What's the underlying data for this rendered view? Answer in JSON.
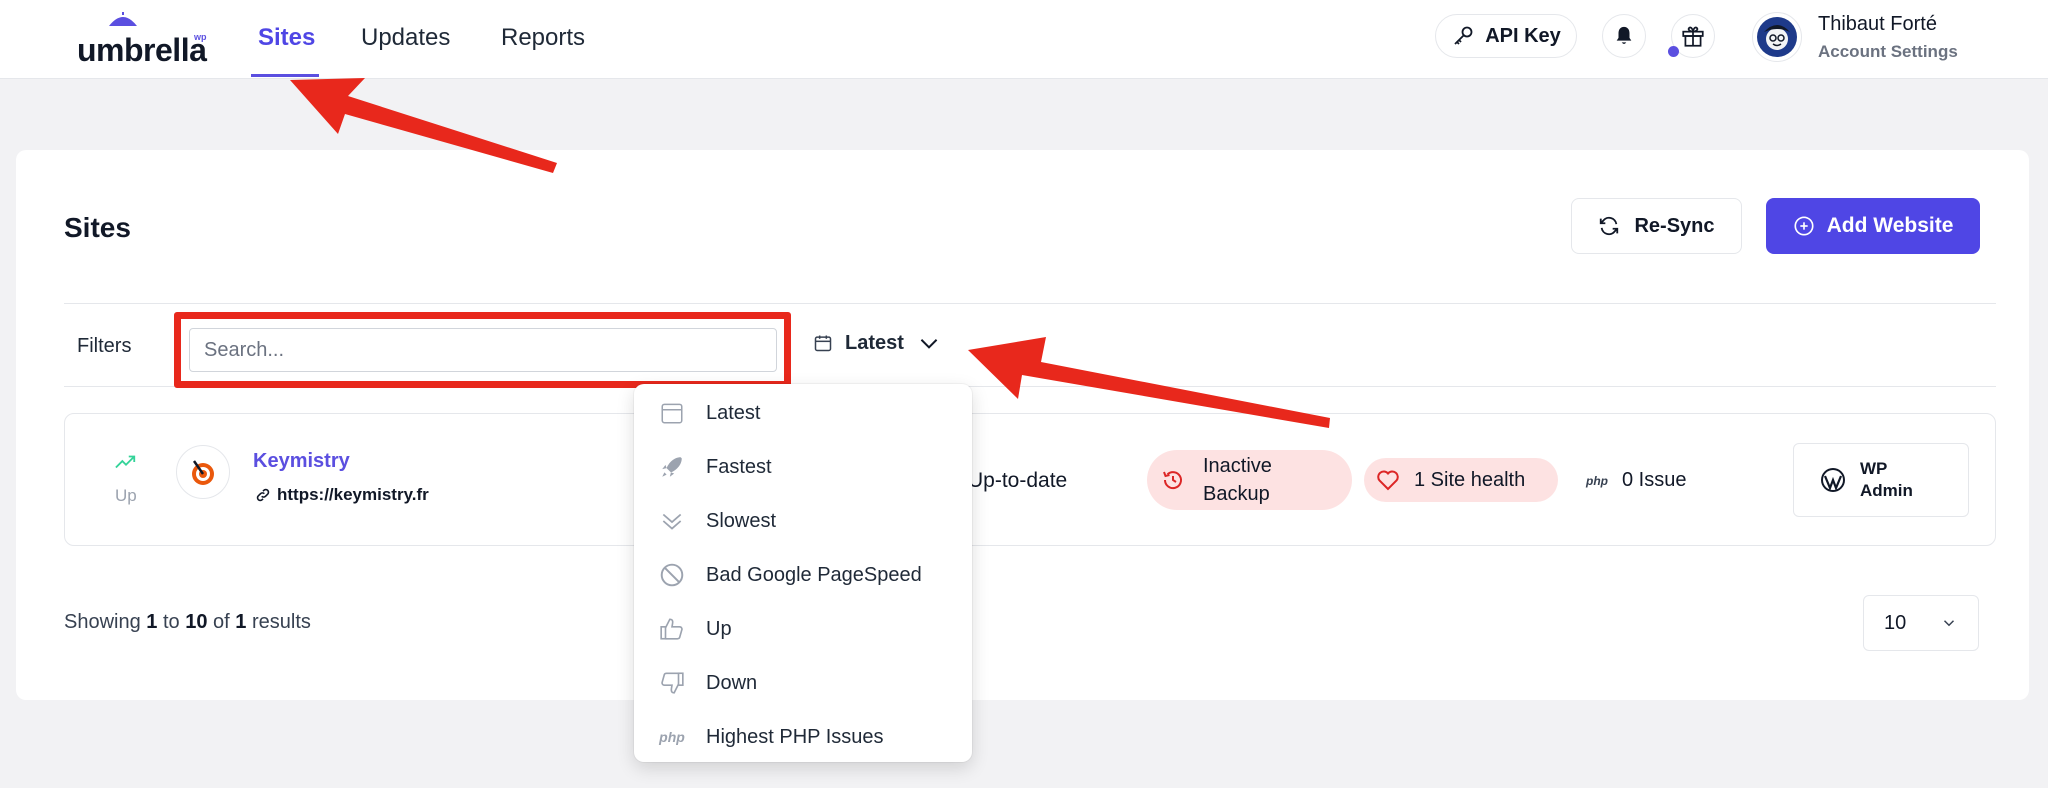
{
  "topbar": {
    "logo_text": "umbrella",
    "logo_badge": "wp",
    "nav": [
      "Sites",
      "Updates",
      "Reports"
    ],
    "api_key_label": "API Key",
    "user_name": "Thibaut Forté",
    "user_sub": "Account Settings"
  },
  "main": {
    "title": "Sites",
    "resync_label": "Re-Sync",
    "add_label": "Add Website",
    "filters_label": "Filters",
    "search_placeholder": "Search...",
    "sort_label": "Latest"
  },
  "site": {
    "status": "Up",
    "name": "Keymistry",
    "url": "https://keymistry.fr",
    "updates": "Up-to-date",
    "backup": "Inactive Backup",
    "health": "1 Site health",
    "php_tag": "php",
    "php_issue": "0 Issue",
    "wp_admin": "WP Admin"
  },
  "pagination": {
    "showing_prefix": "Showing",
    "from": "1",
    "to_word": "to",
    "to": "10",
    "of_word": "of",
    "total": "1",
    "results_word": "results",
    "per_page": "10"
  },
  "dropdown": [
    {
      "icon": "calendar-icon",
      "label": "Latest"
    },
    {
      "icon": "rocket-icon",
      "label": "Fastest"
    },
    {
      "icon": "chevrons-down-icon",
      "label": "Slowest"
    },
    {
      "icon": "ban-icon",
      "label": "Bad Google PageSpeed"
    },
    {
      "icon": "thumbs-up-icon",
      "label": "Up"
    },
    {
      "icon": "thumbs-down-icon",
      "label": "Down"
    },
    {
      "icon": "php-icon",
      "label": "Highest PHP Issues",
      "icon_text": "php"
    }
  ],
  "colors": {
    "accent": "#4f46e5",
    "annotation": "#e8281c",
    "danger_bg": "#fde2e2"
  }
}
